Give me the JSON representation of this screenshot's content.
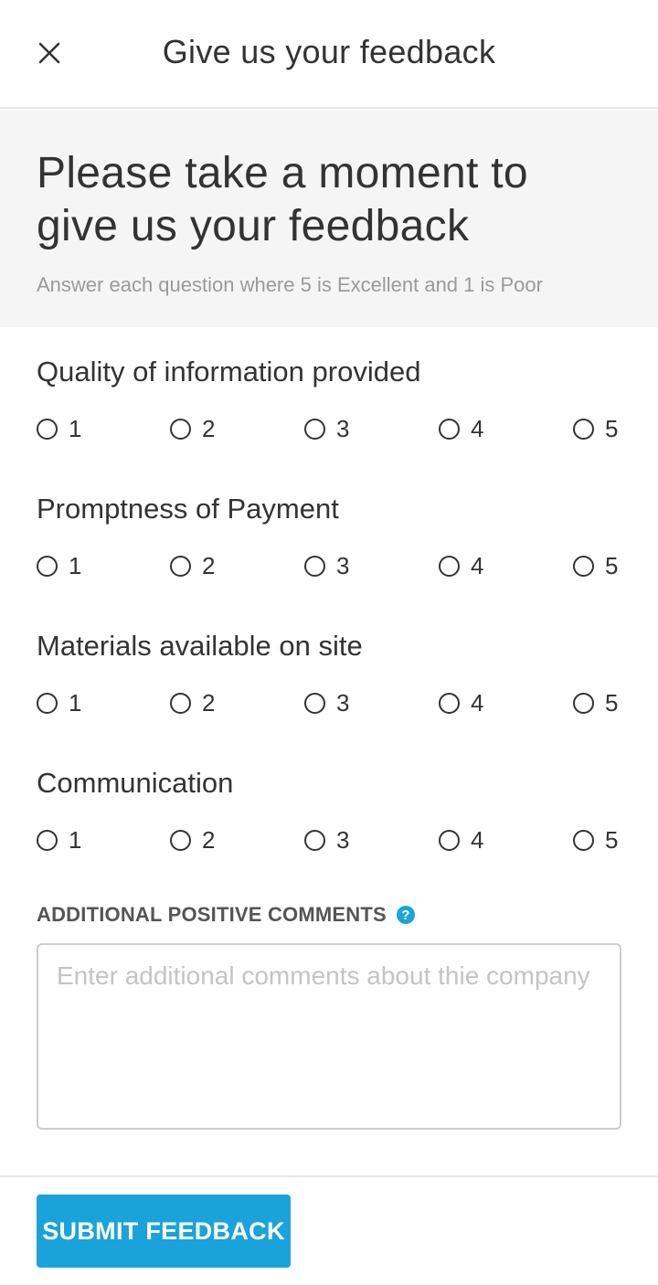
{
  "header": {
    "close_icon": "close-icon",
    "title": "Give us your feedback"
  },
  "intro": {
    "heading": "Please take a moment to give us your feedback",
    "subtext": "Answer each question where 5 is Excellent and 1 is Poor"
  },
  "questions": [
    {
      "label": "Quality of information provided",
      "options": [
        "1",
        "2",
        "3",
        "4",
        "5"
      ]
    },
    {
      "label": "Promptness of Payment",
      "options": [
        "1",
        "2",
        "3",
        "4",
        "5"
      ]
    },
    {
      "label": "Materials available on site",
      "options": [
        "1",
        "2",
        "3",
        "4",
        "5"
      ]
    },
    {
      "label": "Communication",
      "options": [
        "1",
        "2",
        "3",
        "4",
        "5"
      ]
    }
  ],
  "comments": {
    "label": "ADDITIONAL POSITIVE COMMENTS",
    "help_icon": "help-icon",
    "help_glyph": "?",
    "placeholder": "Enter additional comments about thie company",
    "value": ""
  },
  "footer": {
    "submit_label": "SUBMIT FEEDBACK"
  },
  "colors": {
    "accent": "#1aa3db",
    "intro_background": "#f5f5f5",
    "text": "#333333",
    "muted_text": "#9a9a9a"
  }
}
